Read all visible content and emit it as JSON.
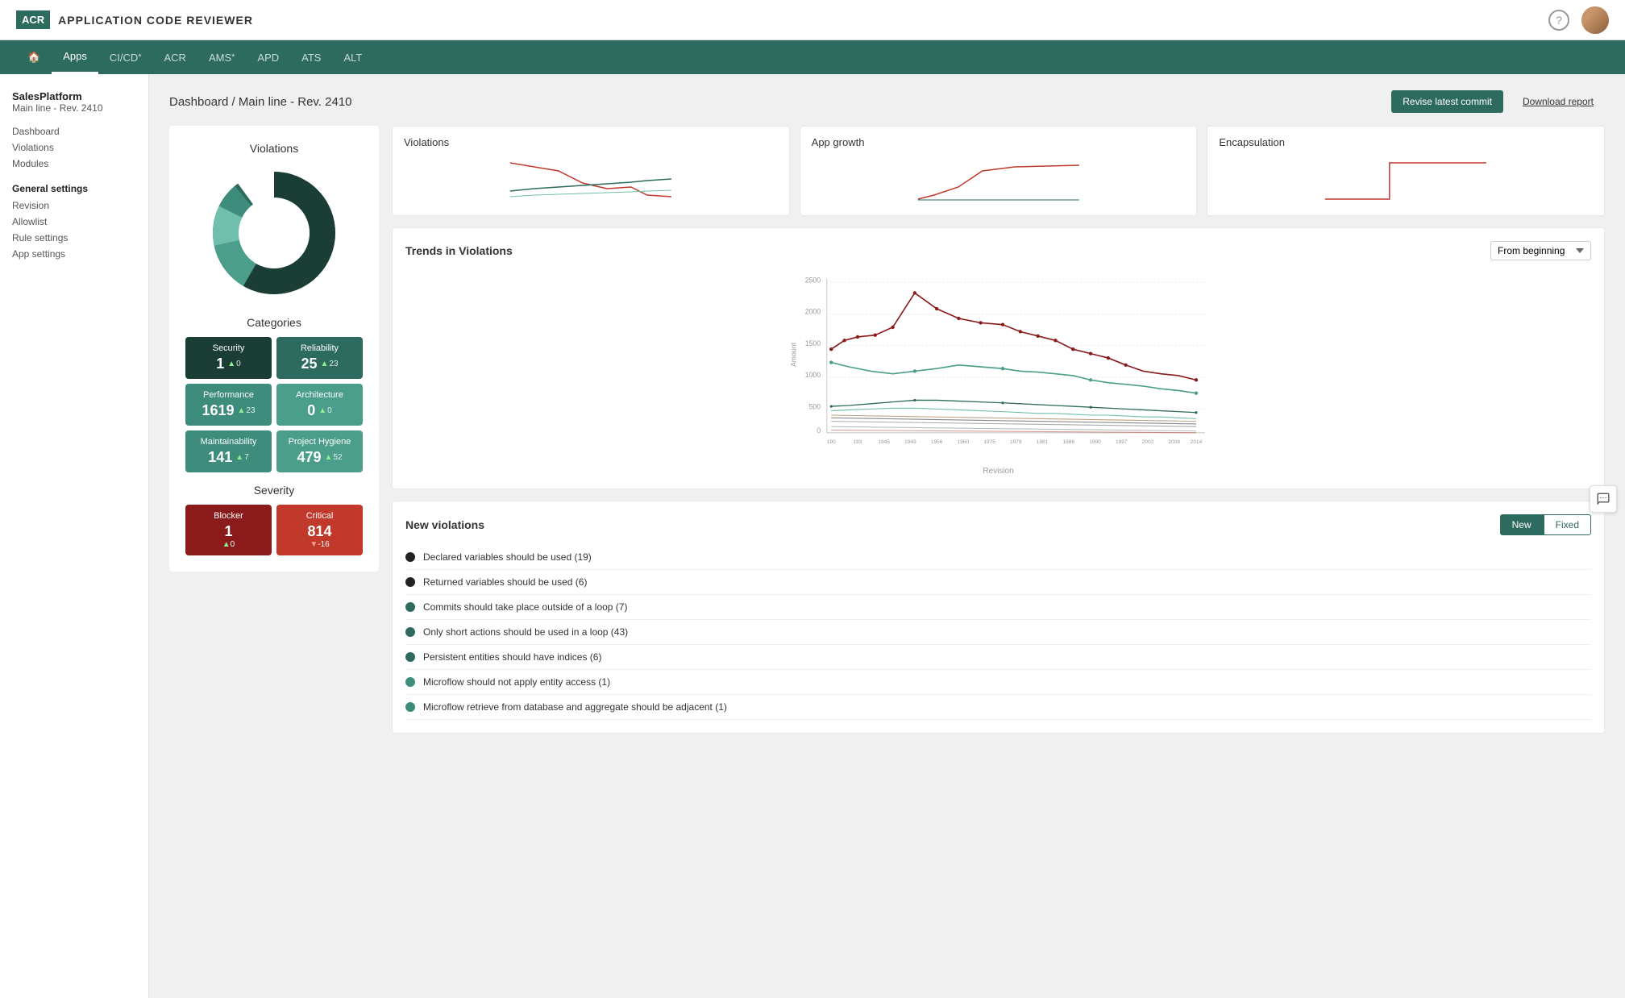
{
  "header": {
    "logo": "ACR",
    "title": "APPLICATION CODE REVIEWER",
    "help_icon": "?",
    "nav_items": [
      {
        "label": "🏠",
        "id": "home",
        "active": false
      },
      {
        "label": "Apps",
        "id": "apps",
        "active": true,
        "asterisk": false
      },
      {
        "label": "CI/CD",
        "id": "cicd",
        "active": false,
        "asterisk": true
      },
      {
        "label": "ACR",
        "id": "acr",
        "active": false,
        "asterisk": false
      },
      {
        "label": "AMS",
        "id": "ams",
        "active": false,
        "asterisk": true
      },
      {
        "label": "APD",
        "id": "apd",
        "active": false,
        "asterisk": false
      },
      {
        "label": "ATS",
        "id": "ats",
        "active": false,
        "asterisk": false
      },
      {
        "label": "ALT",
        "id": "alt",
        "active": false,
        "asterisk": false
      }
    ]
  },
  "sidebar": {
    "app_name": "SalesPlatform",
    "revision": "Main line - Rev. 2410",
    "links": [
      "Dashboard",
      "Violations",
      "Modules"
    ],
    "general_settings_title": "General settings",
    "settings_links": [
      "Revision",
      "Allowlist",
      "Rule settings",
      "App settings"
    ]
  },
  "dashboard": {
    "title": "Dashboard / Main line - Rev. 2410",
    "btn_revise": "Revise latest commit",
    "btn_download": "Download report",
    "violations_title": "Violations",
    "categories_title": "Categories",
    "severity_title": "Severity",
    "categories": [
      {
        "label": "Security",
        "value": "1",
        "change": "0",
        "direction": "up",
        "color": "dark-green"
      },
      {
        "label": "Reliability",
        "value": "25",
        "change": "23",
        "direction": "up",
        "color": "teal"
      },
      {
        "label": "Performance",
        "value": "1619",
        "change": "23",
        "direction": "up",
        "color": "light-teal"
      },
      {
        "label": "Architecture",
        "value": "0",
        "change": "0",
        "direction": "up",
        "color": "medium-teal"
      },
      {
        "label": "Maintainability",
        "value": "141",
        "change": "7",
        "direction": "up",
        "color": "light-teal"
      },
      {
        "label": "Project Hygiene",
        "value": "479",
        "change": "52",
        "direction": "up",
        "color": "medium-teal"
      }
    ],
    "severity": [
      {
        "label": "Blocker",
        "value": "1",
        "change": "0",
        "direction": "up",
        "color": "blocker"
      },
      {
        "label": "Critical",
        "value": "814",
        "change": "16",
        "direction": "down",
        "color": "critical"
      }
    ],
    "mini_charts": [
      {
        "title": "Violations",
        "id": "violations-mini"
      },
      {
        "title": "App growth",
        "id": "app-growth-mini"
      },
      {
        "title": "Encapsulation",
        "id": "encapsulation-mini"
      }
    ],
    "trends_title": "Trends in Violations",
    "trends_select": "From beginning",
    "trends_x_label": "Revision",
    "new_violations_title": "New violations",
    "tab_new": "New",
    "tab_fixed": "Fixed",
    "violations_list": [
      {
        "text": "Declared variables should be used (19)",
        "dot": "black"
      },
      {
        "text": "Returned variables should be used (6)",
        "dot": "black"
      },
      {
        "text": "Commits should take place outside of a loop (7)",
        "dot": "dark-teal"
      },
      {
        "text": "Only short actions should be used in a loop (43)",
        "dot": "dark-teal"
      },
      {
        "text": "Persistent entities should have indices (6)",
        "dot": "dark-teal"
      },
      {
        "text": "Microflow should not apply entity access (1)",
        "dot": "medium-teal"
      },
      {
        "text": "Microflow retrieve from database and aggregate should be adjacent (1)",
        "dot": "medium-teal"
      }
    ]
  }
}
